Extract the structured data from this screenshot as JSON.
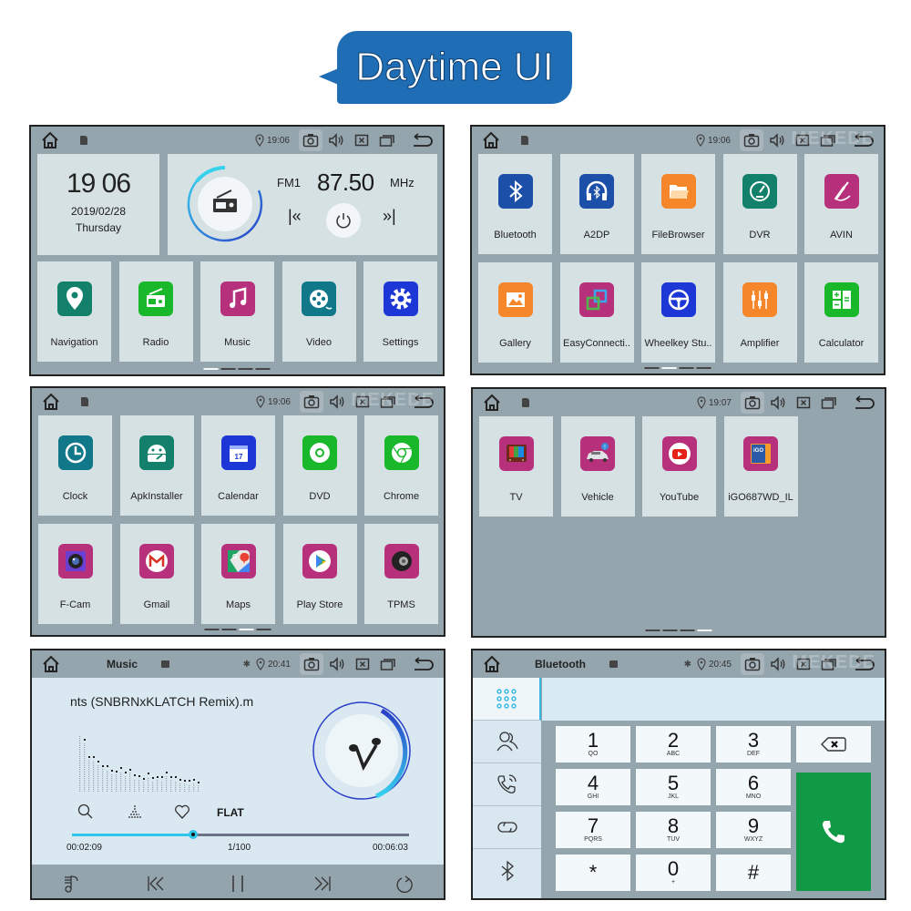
{
  "banner": {
    "title": "Daytime UI",
    "color": "#1f6db5"
  },
  "watermark": "MEKEDE",
  "screens": {
    "home": {
      "status": {
        "time": "19:06"
      },
      "clock": {
        "time": "19 06",
        "date": "2019/02/28",
        "day": "Thursday"
      },
      "radio": {
        "band": "FM1",
        "frequency": "87.50",
        "unit": "MHz",
        "prev": "|«",
        "next": "»|"
      },
      "apps": [
        {
          "label": "Navigation",
          "icon": "location-pin-icon",
          "color": "#12806b"
        },
        {
          "label": "Radio",
          "icon": "radio-icon",
          "color": "#19b72a"
        },
        {
          "label": "Music",
          "icon": "music-note-icon",
          "color": "#b7307c"
        },
        {
          "label": "Video",
          "icon": "film-reel-icon",
          "color": "#11788a"
        },
        {
          "label": "Settings",
          "icon": "gear-icon",
          "color": "#1d36d6"
        }
      ],
      "page_index": 1,
      "page_count": 4
    },
    "apps_page2": {
      "status": {
        "time": "19:06"
      },
      "apps": [
        {
          "label": "Bluetooth",
          "icon": "bluetooth-icon",
          "color": "#1c4fa8"
        },
        {
          "label": "A2DP",
          "icon": "headphones-icon",
          "color": "#1c4fa8"
        },
        {
          "label": "FileBrowser",
          "icon": "folder-icon",
          "color": "#f5862a"
        },
        {
          "label": "DVR",
          "icon": "speedometer-icon",
          "color": "#12806b"
        },
        {
          "label": "AVIN",
          "icon": "audio-jack-icon",
          "color": "#b7307c"
        },
        {
          "label": "Gallery",
          "icon": "image-icon",
          "color": "#f5862a"
        },
        {
          "label": "EasyConnecti..",
          "icon": "screen-mirror-icon",
          "color": "#b7307c"
        },
        {
          "label": "Wheelkey Stu..",
          "icon": "steering-wheel-icon",
          "color": "#1d36d6"
        },
        {
          "label": "Amplifier",
          "icon": "equalizer-icon",
          "color": "#f5862a"
        },
        {
          "label": "Calculator",
          "icon": "calculator-icon",
          "color": "#19b72a"
        }
      ],
      "page_index": 2,
      "page_count": 4
    },
    "apps_page3": {
      "status": {
        "time": "19:06"
      },
      "apps": [
        {
          "label": "Clock",
          "icon": "clock-icon",
          "color": "#11788a"
        },
        {
          "label": "ApkInstaller",
          "icon": "android-icon",
          "color": "#12806b"
        },
        {
          "label": "Calendar",
          "icon": "calendar-icon",
          "color": "#1d36d6",
          "badge": "17"
        },
        {
          "label": "DVD",
          "icon": "disc-icon",
          "color": "#19b72a"
        },
        {
          "label": "Chrome",
          "icon": "chrome-icon",
          "color": "#19b72a"
        },
        {
          "label": "F-Cam",
          "icon": "camera-lens-icon",
          "color": "#b7307c"
        },
        {
          "label": "Gmail",
          "icon": "gmail-icon",
          "color": "#b7307c"
        },
        {
          "label": "Maps",
          "icon": "maps-icon",
          "color": "#b7307c"
        },
        {
          "label": "Play Store",
          "icon": "play-store-icon",
          "color": "#b7307c"
        },
        {
          "label": "TPMS",
          "icon": "tire-icon",
          "color": "#b7307c"
        }
      ],
      "page_index": 3,
      "page_count": 4
    },
    "apps_page4": {
      "status": {
        "time": "19:07"
      },
      "apps": [
        {
          "label": "TV",
          "icon": "tv-icon",
          "color": "#b7307c"
        },
        {
          "label": "Vehicle",
          "icon": "car-icon",
          "color": "#b7307c"
        },
        {
          "label": "YouTube",
          "icon": "youtube-icon",
          "color": "#b7307c"
        },
        {
          "label": "iGO687WD_IL",
          "icon": "igo-icon",
          "color": "#b7307c",
          "badge": "iGO"
        }
      ],
      "page_index": 4,
      "page_count": 4
    },
    "music": {
      "status": {
        "title": "Music",
        "time": "20:41"
      },
      "song_title": "nts (SNBRNxKLATCH Remix).m",
      "eq_preset": "FLAT",
      "elapsed": "00:02:09",
      "track_position": "1/100",
      "duration": "00:06:03",
      "progress_fraction": 0.36
    },
    "bluetooth": {
      "status": {
        "title": "Bluetooth",
        "time": "20:45"
      },
      "sidebar": [
        "dialpad-icon",
        "contacts-icon",
        "call-log-icon",
        "link-icon",
        "bluetooth-icon"
      ],
      "keys": [
        {
          "n": "1",
          "s": "QO"
        },
        {
          "n": "2",
          "s": "ABC"
        },
        {
          "n": "3",
          "s": "DEF"
        },
        {
          "n": "4",
          "s": "GHI"
        },
        {
          "n": "5",
          "s": "JKL"
        },
        {
          "n": "6",
          "s": "MNO"
        },
        {
          "n": "7",
          "s": "PQRS"
        },
        {
          "n": "8",
          "s": "TUV"
        },
        {
          "n": "9",
          "s": "WXYZ"
        },
        {
          "n": "*",
          "s": ""
        },
        {
          "n": "0",
          "s": "+"
        },
        {
          "n": "#",
          "s": ""
        }
      ],
      "call_color": "#119a45"
    }
  }
}
